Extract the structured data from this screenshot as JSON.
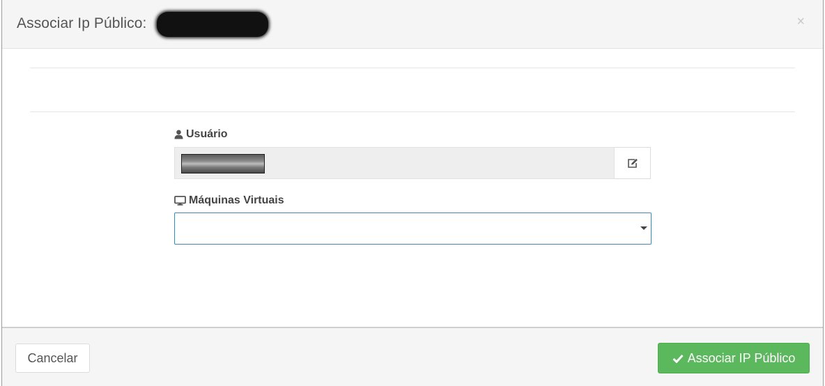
{
  "modal": {
    "title": "Associar Ip Público:",
    "close_symbol": "×"
  },
  "form": {
    "user": {
      "label": "Usuário",
      "icon": "user-icon",
      "value": ""
    },
    "vms": {
      "label": "Máquinas Virtuais",
      "icon": "desktop-icon",
      "selected": ""
    }
  },
  "footer": {
    "cancel_label": "Cancelar",
    "submit_label": "Associar IP Público",
    "submit_icon": "check-icon",
    "submit_color": "#5cb85c"
  }
}
